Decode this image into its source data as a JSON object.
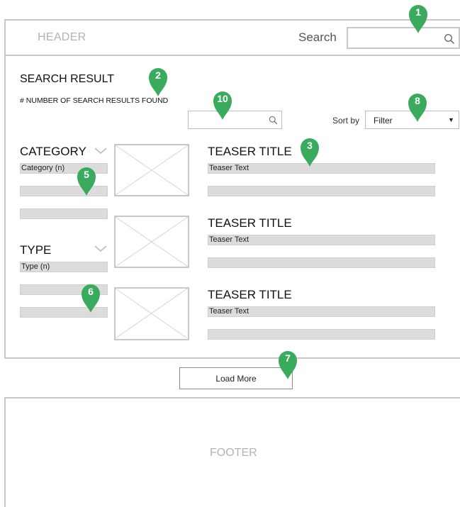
{
  "header": {
    "label": "HEADER",
    "search_label": "Search"
  },
  "results": {
    "title": "SEARCH RESULT",
    "count_text": "# NUMBER OF SEARCH RESULTS FOUND",
    "sort_label": "Sort by",
    "sort_value": "Filter"
  },
  "facets": {
    "category": {
      "title": "CATEGORY",
      "first_item": "Category (n)"
    },
    "type": {
      "title": "TYPE",
      "first_item": "Type (n)"
    }
  },
  "teasers": [
    {
      "title": "TEASER TITLE",
      "text": "Teaser Text"
    },
    {
      "title": "TEASER TITLE",
      "text": "Teaser Text"
    },
    {
      "title": "TEASER TITLE",
      "text": "Teaser Text"
    }
  ],
  "load_more_label": "Load More",
  "footer": {
    "label": "FOOTER"
  },
  "markers": [
    "1",
    "2",
    "3",
    "5",
    "6",
    "7",
    "8",
    "10"
  ],
  "colors": {
    "marker": "#3aab5d",
    "border": "#c8c8c8",
    "bar": "#dcdcdc"
  }
}
